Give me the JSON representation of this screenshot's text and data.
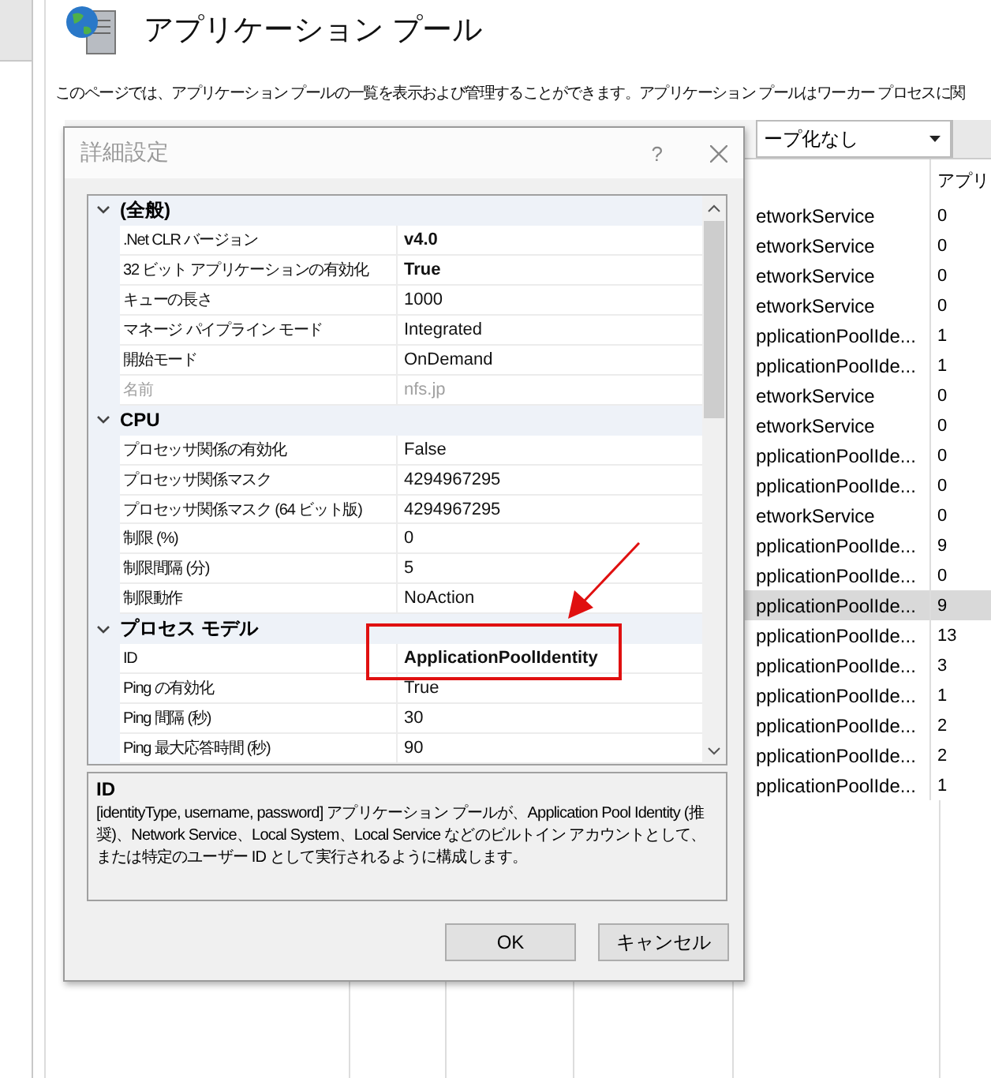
{
  "page": {
    "title": "アプリケーション プール",
    "description": "このページでは、アプリケーション プールの一覧を表示および管理することができます。アプリケーション プールはワーカー プロセスに関"
  },
  "toolbar": {
    "group_by": "ープ化なし"
  },
  "table": {
    "columns": [
      "アプリ"
    ],
    "rows": [
      {
        "identity": "etworkService",
        "column_2": "0",
        "selected": false
      },
      {
        "identity": "etworkService",
        "column_2": "0",
        "selected": false
      },
      {
        "identity": "etworkService",
        "column_2": "0",
        "selected": false
      },
      {
        "identity": "etworkService",
        "column_2": "0",
        "selected": false
      },
      {
        "identity": "pplicationPoolIde...",
        "column_2": "1",
        "selected": false
      },
      {
        "identity": "pplicationPoolIde...",
        "column_2": "1",
        "selected": false
      },
      {
        "identity": "etworkService",
        "column_2": "0",
        "selected": false
      },
      {
        "identity": "etworkService",
        "column_2": "0",
        "selected": false
      },
      {
        "identity": "pplicationPoolIde...",
        "column_2": "0",
        "selected": false
      },
      {
        "identity": "pplicationPoolIde...",
        "column_2": "0",
        "selected": false
      },
      {
        "identity": "etworkService",
        "column_2": "0",
        "selected": false
      },
      {
        "identity": "pplicationPoolIde...",
        "column_2": "9",
        "selected": false
      },
      {
        "identity": "pplicationPoolIde...",
        "column_2": "0",
        "selected": false
      },
      {
        "identity": "pplicationPoolIde...",
        "column_2": "9",
        "selected": true
      },
      {
        "identity": "pplicationPoolIde...",
        "column_2": "13",
        "selected": false
      },
      {
        "identity": "pplicationPoolIde...",
        "column_2": "3",
        "selected": false
      },
      {
        "identity": "pplicationPoolIde...",
        "column_2": "1",
        "selected": false
      },
      {
        "identity": "pplicationPoolIde...",
        "column_2": "2",
        "selected": false
      },
      {
        "identity": "pplicationPoolIde...",
        "column_2": "2",
        "selected": false
      },
      {
        "identity": "pplicationPoolIde...",
        "column_2": "1",
        "selected": false
      }
    ]
  },
  "dialog": {
    "title": "詳細設定",
    "help": "?",
    "categories": [
      {
        "name": "(全般)",
        "expanded": true,
        "properties": [
          {
            "name": ".Net CLR バージョン",
            "value": "v4.0",
            "modified": true,
            "disabled": false
          },
          {
            "name": "32 ビット アプリケーションの有効化",
            "value": "True",
            "modified": true,
            "disabled": false
          },
          {
            "name": "キューの長さ",
            "value": "1000",
            "modified": false,
            "disabled": false
          },
          {
            "name": "マネージ パイプライン モード",
            "value": "Integrated",
            "modified": false,
            "disabled": false
          },
          {
            "name": "開始モード",
            "value": "OnDemand",
            "modified": false,
            "disabled": false
          },
          {
            "name": "名前",
            "value": "nfs.jp",
            "modified": false,
            "disabled": true
          }
        ]
      },
      {
        "name": "CPU",
        "expanded": true,
        "properties": [
          {
            "name": "プロセッサ関係の有効化",
            "value": "False",
            "modified": false,
            "disabled": false
          },
          {
            "name": "プロセッサ関係マスク",
            "value": "4294967295",
            "modified": false,
            "disabled": false
          },
          {
            "name": "プロセッサ関係マスク (64 ビット版)",
            "value": "4294967295",
            "modified": false,
            "disabled": false
          },
          {
            "name": "制限 (%)",
            "value": "0",
            "modified": false,
            "disabled": false
          },
          {
            "name": "制限間隔 (分)",
            "value": "5",
            "modified": false,
            "disabled": false
          },
          {
            "name": "制限動作",
            "value": "NoAction",
            "modified": false,
            "disabled": false
          }
        ]
      },
      {
        "name": "プロセス モデル",
        "expanded": true,
        "properties": [
          {
            "name": "ID",
            "value": "ApplicationPoolIdentity",
            "modified": true,
            "disabled": false
          },
          {
            "name": "Ping の有効化",
            "value": "True",
            "modified": false,
            "disabled": false
          },
          {
            "name": "Ping 間隔 (秒)",
            "value": "30",
            "modified": false,
            "disabled": false
          },
          {
            "name": "Ping 最大応答時間 (秒)",
            "value": "90",
            "modified": false,
            "disabled": false
          }
        ]
      }
    ],
    "description": {
      "title": "ID",
      "text": "[identityType, username, password] アプリケーション プールが、Application Pool Identity (推奨)、Network Service、Local System、Local Service などのビルトイン アカウントとして、または特定のユーザー ID として実行されるように構成します。"
    },
    "buttons": [
      "OK",
      "キャンセル"
    ]
  }
}
